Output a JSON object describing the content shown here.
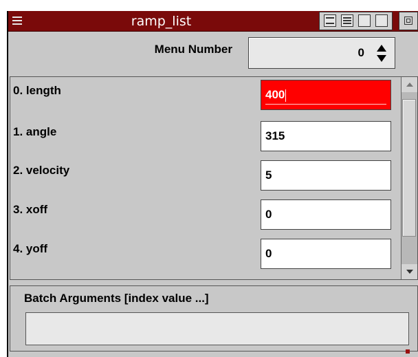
{
  "window": {
    "title": "ramp_list",
    "titlebar_color": "#7a0a0a",
    "icons": [
      "menu-icon",
      "iconify-icon",
      "minimize-icon",
      "maximize-icon",
      "close-icon"
    ]
  },
  "menu_number": {
    "label": "Menu Number",
    "value": "0"
  },
  "rows": [
    {
      "label": "0. length",
      "value": "400",
      "active": true
    },
    {
      "label": "1. angle",
      "value": "315"
    },
    {
      "label": "2. velocity",
      "value": "5"
    },
    {
      "label": "3. xoff",
      "value": "0"
    },
    {
      "label": "4. yoff",
      "value": "0"
    }
  ],
  "batch": {
    "label": "Batch Arguments [index value ...]",
    "value": ""
  },
  "colors": {
    "active_field": "#ff0000",
    "panel_bg": "#c8c8c8"
  }
}
